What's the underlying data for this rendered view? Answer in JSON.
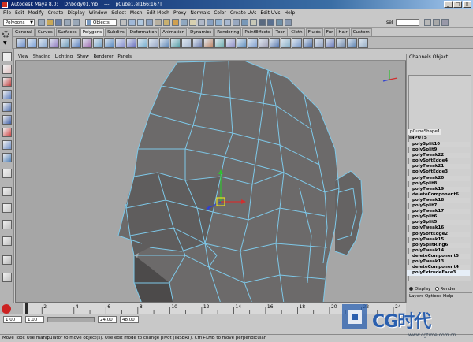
{
  "window": {
    "title_parts": [
      "Autodesk Maya 8.0:",
      "D:\\body01.mb",
      "---",
      "pCube1.e[166:167]"
    ],
    "buttons": [
      "_",
      "□",
      "×"
    ]
  },
  "menubar": [
    "File",
    "Edit",
    "Modify",
    "Create",
    "Display",
    "Window",
    "Select",
    "Mesh",
    "Edit Mesh",
    "Proxy",
    "Normals",
    "Color",
    "Create UVs",
    "Edit UVs",
    "Help"
  ],
  "status_line": {
    "menu_set": "Polygons",
    "selection_mode": "Objects",
    "sel_label": "sel"
  },
  "shelf_tabs": [
    "General",
    "Curves",
    "Surfaces",
    "Polygons",
    "Subdivs",
    "Deformation",
    "Animation",
    "Dynamics",
    "Rendering",
    "PaintEffects",
    "Toon",
    "Cloth",
    "Fluids",
    "Fur",
    "Hair",
    "Custom"
  ],
  "shelf_active_tab": "Polygons",
  "panel_menu": [
    "View",
    "Shading",
    "Lighting",
    "Show",
    "Renderer",
    "Panels"
  ],
  "channel_box": {
    "menu": [
      "Channels",
      "Object"
    ],
    "shape_name": "pCubeShape1",
    "inputs_label": "INPUTS",
    "history": [
      "polySplit10",
      "polySplit9",
      "polyTweak22",
      "polySoftEdge4",
      "polyTweak21",
      "polySoftEdge3",
      "polyTweak20",
      "polySplit8",
      "polyTweak19",
      "deleteComponent6",
      "polyTweak18",
      "polySplit7",
      "polyTweak17",
      "polySplit6",
      "polySplit5",
      "polyTweak16",
      "polySoftEdge2",
      "polyTweak15",
      "polySplitRing6",
      "polyTweak14",
      "deleteComponent5",
      "polyTweak13",
      "deleteComponent4",
      "polyExtrudeFace3"
    ],
    "display_options": [
      "Display",
      "Render"
    ],
    "display_selected": "Display",
    "layers_menu": [
      "Layers",
      "Options",
      "Help"
    ]
  },
  "time_slider": {
    "labels": [
      "2",
      "4",
      "6",
      "8",
      "10",
      "12",
      "14",
      "16",
      "18",
      "20",
      "22",
      "24"
    ],
    "current_frame": "1"
  },
  "range_slider": {
    "start": "1.00",
    "start2": "1.00",
    "end": "24.00",
    "end2": "48.00"
  },
  "help_line": "Move Tool: Use manipulator to move object(s). Use edit mode to change pivot (INSERT). Ctrl+LMB to move perpendicular.",
  "watermark": {
    "brand": "CG时代",
    "url": "www.cgtime.com.cn"
  },
  "colors": {
    "viewport_bg": "#a6a6a6",
    "mesh_fill": "#6e6c6c",
    "wire": "#7ec8e8",
    "accent": "#2a5fae"
  }
}
